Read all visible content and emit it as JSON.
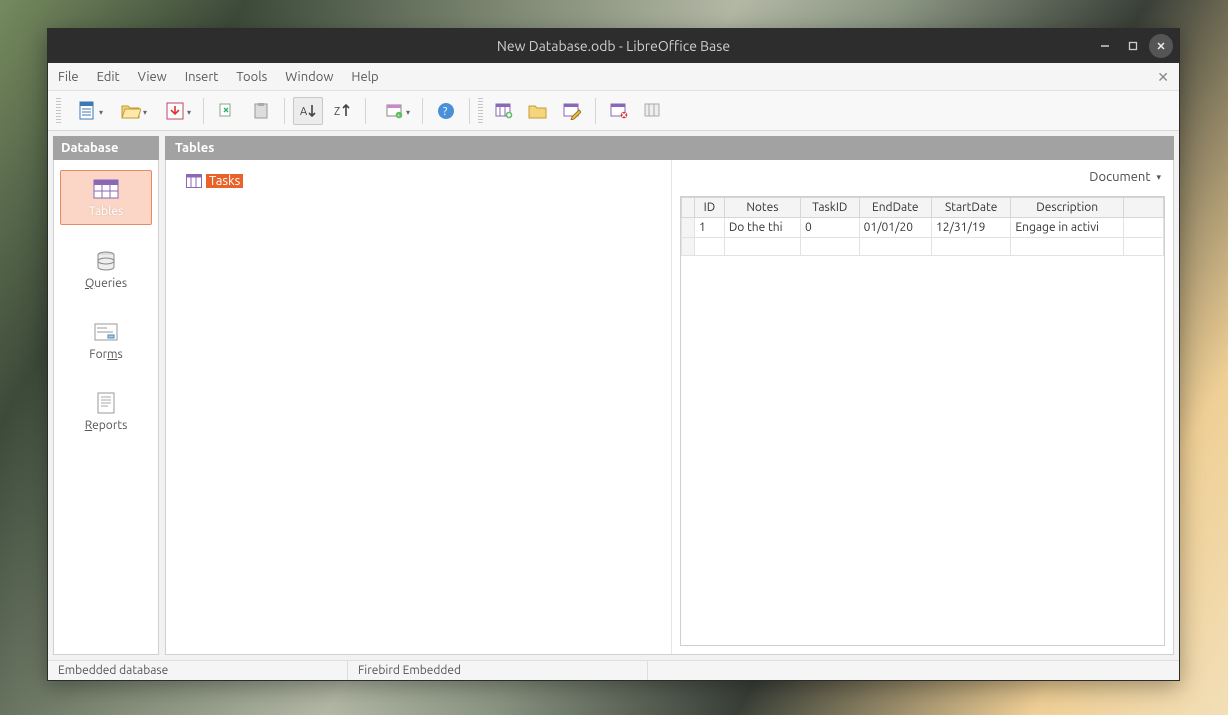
{
  "window": {
    "title": "New Database.odb - LibreOffice Base"
  },
  "menus": [
    "File",
    "Edit",
    "View",
    "Insert",
    "Tools",
    "Window",
    "Help"
  ],
  "sidebar": {
    "header": "Database",
    "items": [
      {
        "label": "Tables",
        "id": "tables"
      },
      {
        "label": "Queries",
        "id": "queries"
      },
      {
        "label": "Forms",
        "id": "forms"
      },
      {
        "label": "Reports",
        "id": "reports"
      }
    ]
  },
  "main": {
    "header": "Tables",
    "table_list": [
      {
        "name": "Tasks"
      }
    ],
    "preview_mode": "Document"
  },
  "preview_grid": {
    "columns": [
      "ID",
      "Notes",
      "TaskID",
      "EndDate",
      "StartDate",
      "Description"
    ],
    "rows": [
      {
        "ID": "1",
        "Notes": "Do the thi",
        "TaskID": "0",
        "EndDate": "01/01/20",
        "StartDate": "12/31/19",
        "Description": "Engage in activi"
      }
    ]
  },
  "statusbar": {
    "left": "Embedded database",
    "right": "Firebird Embedded"
  },
  "chart_data": {
    "type": "table",
    "title": "Tasks",
    "columns": [
      "ID",
      "Notes",
      "TaskID",
      "EndDate",
      "StartDate",
      "Description"
    ],
    "rows": [
      [
        "1",
        "Do the thi",
        "0",
        "01/01/20",
        "12/31/19",
        "Engage in activi"
      ]
    ]
  }
}
